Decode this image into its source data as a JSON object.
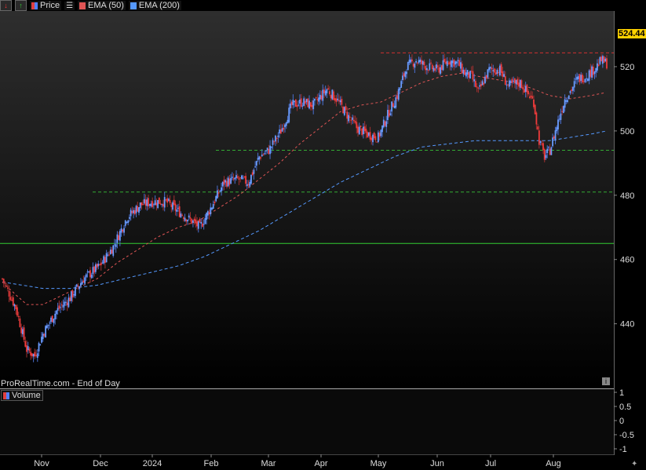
{
  "toolbar": {
    "price_label": "Price",
    "ema50_label": "EMA (50)",
    "ema200_label": "EMA (200)",
    "ema50_color": "#e05555",
    "ema200_color": "#5599ff"
  },
  "watermark": "ProRealTime.com - End of Day",
  "last_price": "524.44",
  "volume_label": "Volume",
  "chart_data": {
    "type": "candlestick",
    "title": "",
    "price_axis_ticks": [
      "520",
      "500",
      "480",
      "460",
      "440"
    ],
    "volume_axis_ticks": [
      "1",
      "0.5",
      "0",
      "-0.5",
      "-1"
    ],
    "x_ticks": [
      "Nov",
      "Dec",
      "2024",
      "Feb",
      "Mar",
      "Apr",
      "May",
      "Jun",
      "Jul",
      "Aug"
    ],
    "ylim": [
      426,
      530
    ],
    "horizontal_lines": [
      {
        "value": 524.3,
        "color": "#d03030",
        "style": "dashed"
      },
      {
        "value": 494.0,
        "color": "#33aa33",
        "style": "dashed"
      },
      {
        "value": 481.0,
        "color": "#33aa33",
        "style": "dashed"
      },
      {
        "value": 465.0,
        "color": "#33cc33",
        "style": "solid"
      }
    ],
    "close_path": [
      [
        0,
        454
      ],
      [
        10,
        445
      ],
      [
        18,
        432
      ],
      [
        24,
        430
      ],
      [
        30,
        437
      ],
      [
        40,
        444
      ],
      [
        50,
        448
      ],
      [
        60,
        454
      ],
      [
        72,
        458
      ],
      [
        82,
        464
      ],
      [
        92,
        473
      ],
      [
        102,
        477
      ],
      [
        112,
        478
      ],
      [
        121,
        478
      ],
      [
        130,
        475
      ],
      [
        140,
        472
      ],
      [
        146,
        470
      ],
      [
        154,
        476
      ],
      [
        164,
        484
      ],
      [
        174,
        485
      ],
      [
        182,
        484
      ],
      [
        190,
        492
      ],
      [
        197,
        494
      ],
      [
        206,
        500
      ],
      [
        214,
        508
      ],
      [
        222,
        509
      ],
      [
        230,
        508
      ],
      [
        240,
        513
      ],
      [
        247,
        510
      ],
      [
        255,
        505
      ],
      [
        262,
        501
      ],
      [
        270,
        499
      ],
      [
        278,
        498
      ],
      [
        286,
        506
      ],
      [
        292,
        511
      ],
      [
        299,
        520
      ],
      [
        306,
        522
      ],
      [
        314,
        520
      ],
      [
        322,
        519
      ],
      [
        330,
        522
      ],
      [
        337,
        521
      ],
      [
        342,
        518
      ],
      [
        347,
        517
      ],
      [
        352,
        512
      ],
      [
        360,
        519
      ],
      [
        368,
        519
      ],
      [
        374,
        514
      ],
      [
        383,
        515
      ],
      [
        393,
        509
      ],
      [
        397,
        497
      ],
      [
        401,
        492
      ],
      [
        405,
        494
      ],
      [
        411,
        503
      ],
      [
        416,
        510
      ],
      [
        421,
        513
      ],
      [
        425,
        516
      ],
      [
        431,
        517
      ],
      [
        437,
        519
      ],
      [
        443,
        522
      ],
      [
        447,
        521
      ]
    ],
    "ema50_path": [
      [
        0,
        453
      ],
      [
        10,
        449
      ],
      [
        18,
        446
      ],
      [
        30,
        446
      ],
      [
        40,
        448
      ],
      [
        55,
        451
      ],
      [
        70,
        454
      ],
      [
        85,
        459
      ],
      [
        100,
        463
      ],
      [
        115,
        467
      ],
      [
        130,
        470
      ],
      [
        145,
        472
      ],
      [
        160,
        476
      ],
      [
        175,
        480
      ],
      [
        190,
        485
      ],
      [
        205,
        490
      ],
      [
        220,
        496
      ],
      [
        235,
        501
      ],
      [
        250,
        506
      ],
      [
        265,
        508
      ],
      [
        280,
        509
      ],
      [
        295,
        512
      ],
      [
        310,
        515
      ],
      [
        325,
        517
      ],
      [
        340,
        518
      ],
      [
        352,
        517
      ],
      [
        365,
        516
      ],
      [
        380,
        515
      ],
      [
        393,
        513
      ],
      [
        405,
        511
      ],
      [
        420,
        510
      ],
      [
        435,
        511
      ],
      [
        447,
        512
      ]
    ],
    "ema200_path": [
      [
        0,
        453
      ],
      [
        15,
        452
      ],
      [
        30,
        451
      ],
      [
        50,
        451
      ],
      [
        70,
        452
      ],
      [
        90,
        454
      ],
      [
        110,
        456
      ],
      [
        130,
        458
      ],
      [
        150,
        461
      ],
      [
        170,
        465
      ],
      [
        190,
        469
      ],
      [
        210,
        474
      ],
      [
        230,
        479
      ],
      [
        250,
        484
      ],
      [
        270,
        488
      ],
      [
        290,
        492
      ],
      [
        310,
        495
      ],
      [
        330,
        496
      ],
      [
        350,
        497
      ],
      [
        370,
        497
      ],
      [
        390,
        497
      ],
      [
        405,
        497
      ],
      [
        420,
        498
      ],
      [
        435,
        499
      ],
      [
        447,
        500
      ]
    ]
  }
}
